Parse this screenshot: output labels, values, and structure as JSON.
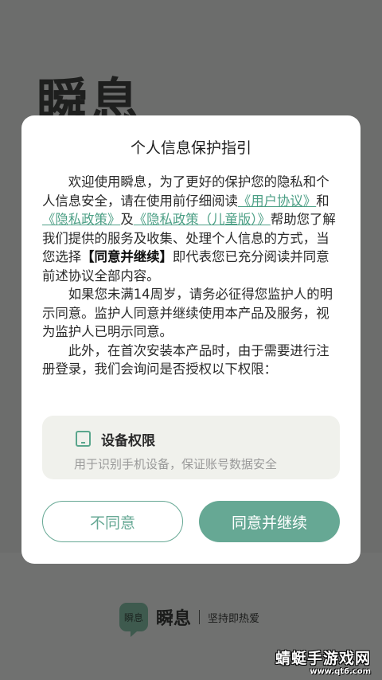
{
  "background": {
    "app_title": "瞬息",
    "brand_logo_text": "瞬息",
    "brand_name": "瞬息",
    "brand_slogan": "坚持即热爱"
  },
  "watermark": {
    "main": "蜻蜓手游戏网",
    "sub": "www.qt6.com"
  },
  "dialog": {
    "title": "个人信息保护指引",
    "para1": {
      "t1": "欢迎使用瞬息，为了更好的保护您的隐私和个人信息安全，请在使用前仔细阅读",
      "link_user": "《用户协议》",
      "t2": "和",
      "link_privacy": "《隐私政策》",
      "t3": "及",
      "link_child": "《隐私政策（儿童版）》",
      "t4": "帮助您了解我们提供的服务及收集、处理个人信息的方式，当您选择",
      "strong": "【同意并继续】",
      "t5": "即代表您已充分阅读并同意前述协议全部内容。"
    },
    "para2": "如果您未满14周岁，请务必征得您监护人的明示同意。监护人同意并继续使用本产品及服务，视为监护人已明示同意。",
    "para3": "此外，在首次安装本产品时，由于需要进行注册登录，我们会询问是否授权以下权限：",
    "permission": {
      "icon": "phone-icon",
      "title": "设备权限",
      "desc": "用于识别手机设备，保证账号数据安全"
    },
    "buttons": {
      "disagree": "不同意",
      "agree": "同意并继续"
    }
  },
  "colors": {
    "accent": "#66a894",
    "link": "#4c9f85",
    "overlay": "#6f706f"
  }
}
